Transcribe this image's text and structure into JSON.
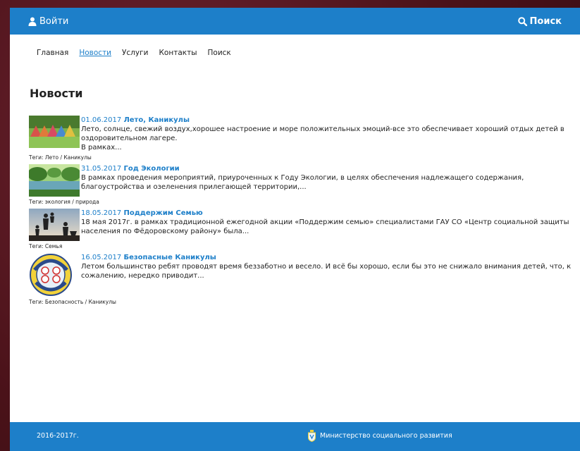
{
  "header": {
    "login_label": "Войти",
    "search_label": "Поиск",
    "icons": {
      "login": "user-icon",
      "search": "search-icon"
    }
  },
  "nav": {
    "items": [
      {
        "label": "Главная"
      },
      {
        "label": "Новости",
        "active": true
      },
      {
        "label": "Услуги"
      },
      {
        "label": "Контакты"
      },
      {
        "label": "Поиск"
      }
    ]
  },
  "page": {
    "title": "Новости"
  },
  "news": [
    {
      "date": "01.06.2017",
      "title": "Лето, Каникулы",
      "text": "Лето, солнце, свежий воздух,хорошее настроение и море положительных эмоций-все это обеспечивает хороший отдых детей в оздоровительном лагере.",
      "more": "В рамках...",
      "tags": "Теги:  Лето / Каникулы"
    },
    {
      "date": "31.05.2017",
      "title": "Год Экологии",
      "text": "В рамках проведения мероприятий, приуроченных к Году Экологии, в целях обеспечения надлежащего содержания, благоустройства и озеленения прилегающей территории,...",
      "more": "",
      "tags": "Теги:  экология / природа"
    },
    {
      "date": "18.05.2017",
      "title": "Поддержим Семью",
      "text": "18 мая 2017г. в рамках традиционной ежегодной акции «Поддержим семью» специалистами ГАУ СО «Центр социальной защиты населения по Фёдоровскому району»  была...",
      "more": "",
      "tags": "Теги:  Семья"
    },
    {
      "date": "16.05.2017",
      "title": "Безопасные Каникулы",
      "text": "Летом большинство ребят проводят время беззаботно и весело. И всё бы хорошо, если бы это не снижало внимания детей, что, к сожалению, нередко приводит...",
      "more": "",
      "tags": "Теги:  Безопасность / Каникулы"
    }
  ],
  "footer": {
    "copyright": "2016-2017г.",
    "ministry": "Министерство социального развития"
  },
  "colors": {
    "accent": "#1d7fc9",
    "frame": "#5a1a22"
  }
}
